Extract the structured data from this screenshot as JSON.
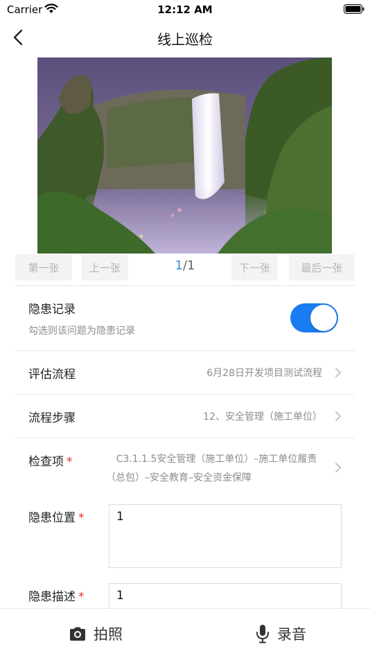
{
  "status_bar": {
    "carrier": "Carrier",
    "time": "12:12 AM"
  },
  "nav": {
    "title": "线上巡检"
  },
  "pager": {
    "first": "第一张",
    "prev": "上一张",
    "current": "1",
    "total": "/1",
    "next": "下一张",
    "last": "最后一张"
  },
  "hazard_record": {
    "label": "隐患记录",
    "hint": "勾选则该问题为隐患记录",
    "enabled": true
  },
  "evaluation_flow": {
    "label": "评估流程",
    "value": "6月28日开发项目测试流程"
  },
  "flow_step": {
    "label": "流程步骤",
    "value": "12、安全管理（施工单位）"
  },
  "check_item": {
    "label": "检查项",
    "required_mark": "*",
    "value_line1": "C3.1.1.5安全管理（施工单位）–施工单位履责",
    "value_line2": "（总包）–安全教育–安全资金保障"
  },
  "hazard_location": {
    "label": "隐患位置",
    "required_mark": "*",
    "value": "1"
  },
  "hazard_description": {
    "label": "隐患描述",
    "required_mark": "*",
    "value": "1"
  },
  "bottom_bar": {
    "photo_label": "拍照",
    "record_label": "录音"
  },
  "colors": {
    "accent": "#1a7cf2",
    "required": "#e0302f",
    "muted": "#8c8c8c"
  }
}
